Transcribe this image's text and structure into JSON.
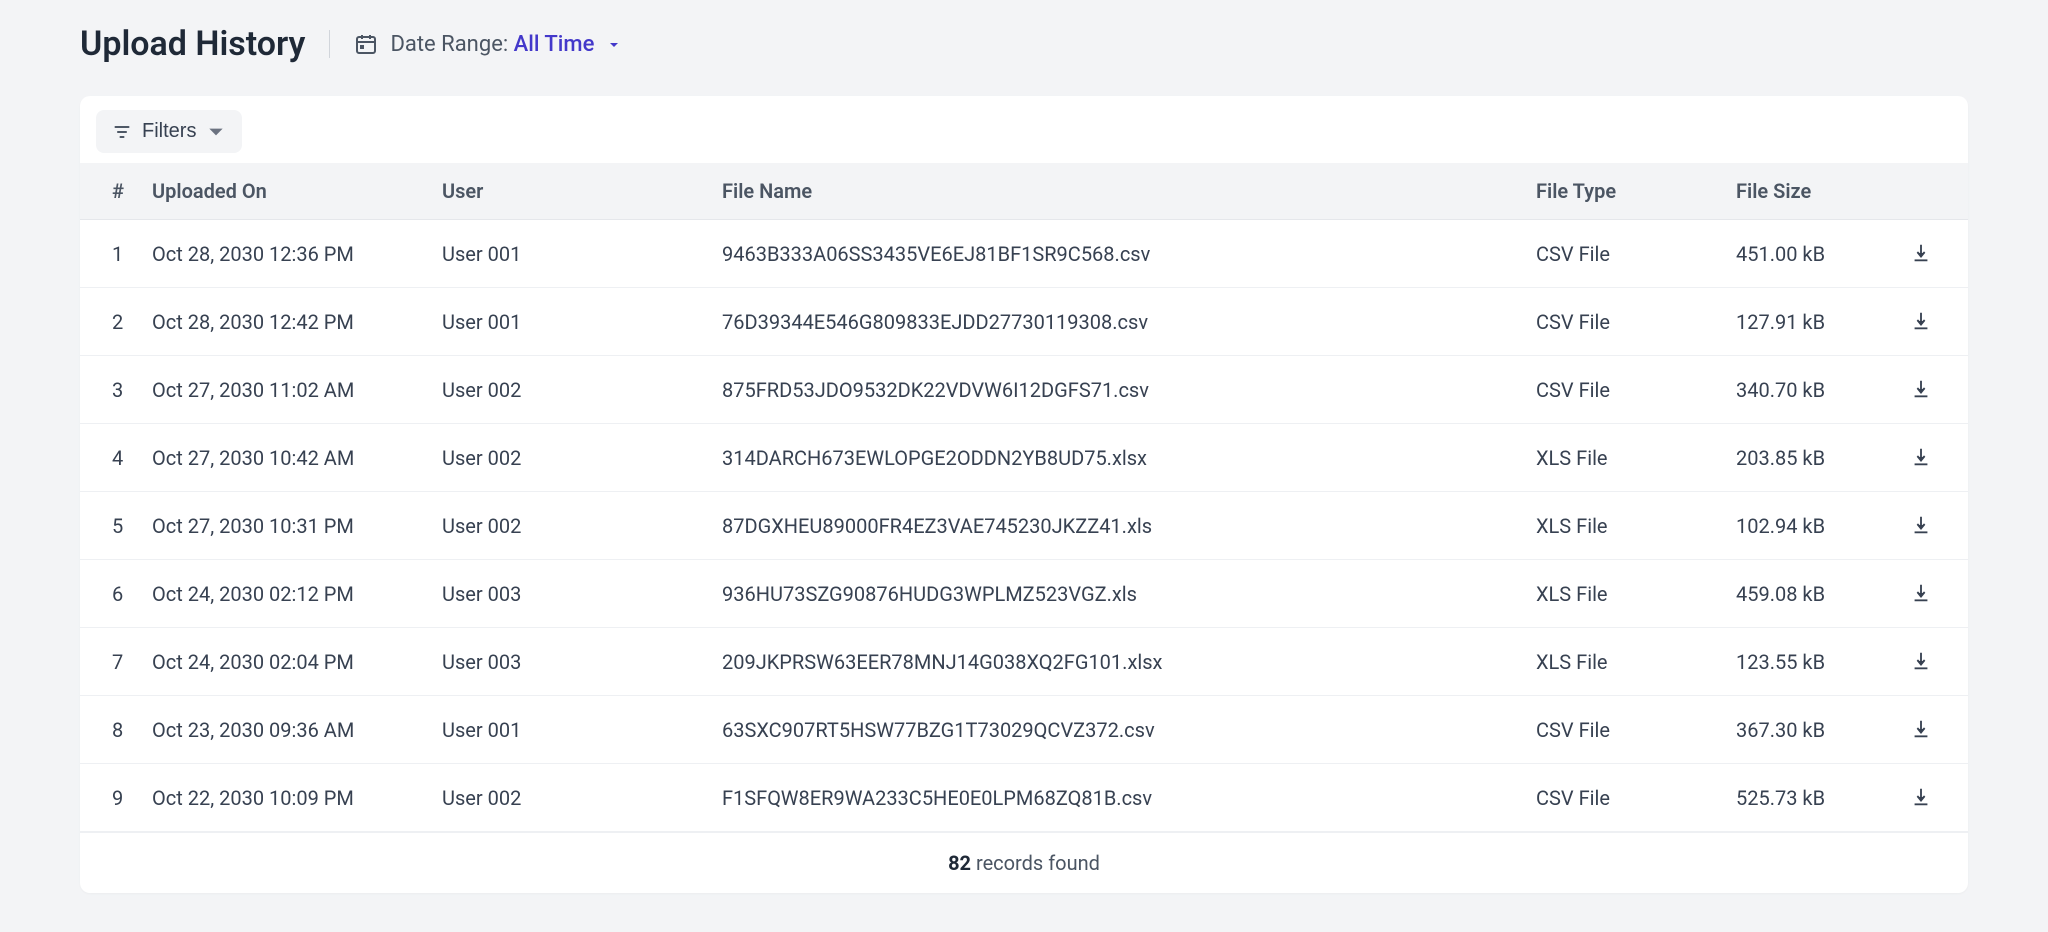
{
  "header": {
    "title": "Upload History",
    "date_label": "Date Range: ",
    "date_value": "All Time"
  },
  "toolbar": {
    "filters_label": "Filters"
  },
  "table": {
    "columns": {
      "index": "#",
      "uploaded_on": "Uploaded On",
      "user": "User",
      "file_name": "File Name",
      "file_type": "File Type",
      "file_size": "File Size"
    },
    "rows": [
      {
        "index": "1",
        "uploaded_on": "Oct 28, 2030 12:36 PM",
        "user": "User 001",
        "file_name": "9463B333A06SS3435VE6EJ81BF1SR9C568.csv",
        "file_type": "CSV File",
        "file_size": "451.00 kB"
      },
      {
        "index": "2",
        "uploaded_on": "Oct 28, 2030 12:42 PM",
        "user": "User 001",
        "file_name": "76D39344E546G809833EJDD27730119308.csv",
        "file_type": "CSV File",
        "file_size": "127.91 kB"
      },
      {
        "index": "3",
        "uploaded_on": "Oct 27, 2030 11:02 AM",
        "user": "User 002",
        "file_name": "875FRD53JDO9532DK22VDVW6I12DGFS71.csv",
        "file_type": "CSV File",
        "file_size": "340.70 kB"
      },
      {
        "index": "4",
        "uploaded_on": "Oct 27, 2030 10:42 AM",
        "user": "User 002",
        "file_name": "314DARCH673EWLOPGE2ODDN2YB8UD75.xlsx",
        "file_type": "XLS File",
        "file_size": "203.85 kB"
      },
      {
        "index": "5",
        "uploaded_on": "Oct 27, 2030 10:31 PM",
        "user": "User 002",
        "file_name": "87DGXHEU89000FR4EZ3VAE745230JKZZ41.xls",
        "file_type": "XLS File",
        "file_size": "102.94 kB"
      },
      {
        "index": "6",
        "uploaded_on": "Oct 24, 2030 02:12 PM",
        "user": "User 003",
        "file_name": "936HU73SZG90876HUDG3WPLMZ523VGZ.xls",
        "file_type": "XLS File",
        "file_size": "459.08 kB"
      },
      {
        "index": "7",
        "uploaded_on": "Oct 24, 2030 02:04 PM",
        "user": "User 003",
        "file_name": "209JKPRSW63EER78MNJ14G038XQ2FG101.xlsx",
        "file_type": "XLS File",
        "file_size": "123.55 kB"
      },
      {
        "index": "8",
        "uploaded_on": "Oct 23, 2030 09:36 AM",
        "user": "User 001",
        "file_name": "63SXC907RT5HSW77BZG1T73029QCVZ372.csv",
        "file_type": "CSV File",
        "file_size": "367.30 kB"
      },
      {
        "index": "9",
        "uploaded_on": "Oct 22, 2030 10:09 PM",
        "user": "User 002",
        "file_name": "F1SFQW8ER9WA233C5HE0E0LPM68ZQ81B.csv",
        "file_type": "CSV File",
        "file_size": "525.73 kB"
      }
    ]
  },
  "footer": {
    "count": "82",
    "suffix": " records found"
  }
}
